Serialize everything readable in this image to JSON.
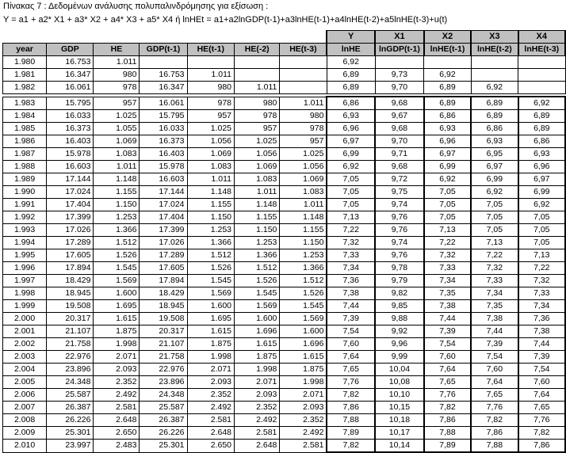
{
  "title_line1": "Πίνακας 7 : Δεδομένων ανάλυσης πολυπαλινδρόμησης για εξίσωση :",
  "title_line2": "Y = a1 + a2* X1 + a3* X2 + a4* X3 + a5* X4  ή   lnHEt = a1+a2lnGDP(t-1)+a3lnHE(t-1)+a4lnHE(t-2)+a5lnHE(t-3)+u(t)",
  "var_labels": [
    "Y",
    "X1",
    "X2",
    "X3",
    "X4"
  ],
  "headers": [
    "year",
    "GDP",
    "HE",
    "GDP(t-1)",
    "HE(t-1)",
    "HE(-2)",
    "HE(t-3)",
    "lnHE",
    "lnGDP(t-1)",
    "lnHE(t-1)",
    "lnHE(t-2)",
    "lnHE(t-3)"
  ],
  "rows_top": [
    [
      "1.980",
      "16.753",
      "1.011",
      "",
      "",
      "",
      "",
      "6,92",
      "",
      "",
      "",
      ""
    ],
    [
      "1.981",
      "16.347",
      "980",
      "16.753",
      "1.011",
      "",
      "",
      "6,89",
      "9,73",
      "6,92",
      "",
      ""
    ],
    [
      "1.982",
      "16.061",
      "978",
      "16.347",
      "980",
      "1.011",
      "",
      "6,89",
      "9,70",
      "6,89",
      "6,92",
      ""
    ]
  ],
  "rows_main": [
    [
      "1.983",
      "15.795",
      "957",
      "16.061",
      "978",
      "980",
      "1.011",
      "6,86",
      "9,68",
      "6,89",
      "6,89",
      "6,92"
    ],
    [
      "1.984",
      "16.033",
      "1.025",
      "15.795",
      "957",
      "978",
      "980",
      "6,93",
      "9,67",
      "6,86",
      "6,89",
      "6,89"
    ],
    [
      "1.985",
      "16.373",
      "1.055",
      "16.033",
      "1.025",
      "957",
      "978",
      "6,96",
      "9,68",
      "6,93",
      "6,86",
      "6,89"
    ],
    [
      "1.986",
      "16.403",
      "1.069",
      "16.373",
      "1.056",
      "1.025",
      "957",
      "6,97",
      "9,70",
      "6,96",
      "6,93",
      "6,86"
    ],
    [
      "1.987",
      "15.978",
      "1.083",
      "16.403",
      "1.069",
      "1.056",
      "1.025",
      "6,99",
      "9,71",
      "6,97",
      "6,95",
      "6,93"
    ],
    [
      "1.988",
      "16.603",
      "1.011",
      "15.978",
      "1.083",
      "1.069",
      "1.056",
      "6,92",
      "9,68",
      "6,99",
      "6,97",
      "6,96"
    ],
    [
      "1.989",
      "17.144",
      "1.148",
      "16.603",
      "1.011",
      "1.083",
      "1.069",
      "7,05",
      "9,72",
      "6,92",
      "6,99",
      "6,97"
    ],
    [
      "1.990",
      "17.024",
      "1.155",
      "17.144",
      "1.148",
      "1.011",
      "1.083",
      "7,05",
      "9,75",
      "7,05",
      "6,92",
      "6,99"
    ],
    [
      "1.991",
      "17.404",
      "1.150",
      "17.024",
      "1.155",
      "1.148",
      "1.011",
      "7,05",
      "9,74",
      "7,05",
      "7,05",
      "6,92"
    ],
    [
      "1.992",
      "17.399",
      "1.253",
      "17.404",
      "1.150",
      "1.155",
      "1.148",
      "7,13",
      "9,76",
      "7,05",
      "7,05",
      "7,05"
    ],
    [
      "1.993",
      "17.026",
      "1.366",
      "17.399",
      "1.253",
      "1.150",
      "1.155",
      "7,22",
      "9,76",
      "7,13",
      "7,05",
      "7,05"
    ],
    [
      "1.994",
      "17.289",
      "1.512",
      "17.026",
      "1.366",
      "1.253",
      "1.150",
      "7,32",
      "9,74",
      "7,22",
      "7,13",
      "7,05"
    ],
    [
      "1.995",
      "17.605",
      "1.526",
      "17.289",
      "1.512",
      "1.366",
      "1.253",
      "7,33",
      "9,76",
      "7,32",
      "7,22",
      "7,13"
    ],
    [
      "1.996",
      "17.894",
      "1.545",
      "17.605",
      "1.526",
      "1.512",
      "1.366",
      "7,34",
      "9,78",
      "7,33",
      "7,32",
      "7,22"
    ],
    [
      "1.997",
      "18.429",
      "1.569",
      "17.894",
      "1.545",
      "1.526",
      "1.512",
      "7,36",
      "9,79",
      "7,34",
      "7,33",
      "7,32"
    ],
    [
      "1.998",
      "18.945",
      "1.600",
      "18.429",
      "1.569",
      "1.545",
      "1.526",
      "7,38",
      "9,82",
      "7,35",
      "7,34",
      "7,33"
    ],
    [
      "1.999",
      "19.508",
      "1.695",
      "18.945",
      "1.600",
      "1.569",
      "1.545",
      "7,44",
      "9,85",
      "7,38",
      "7,35",
      "7,34"
    ],
    [
      "2.000",
      "20.317",
      "1.615",
      "19.508",
      "1.695",
      "1.600",
      "1.569",
      "7,39",
      "9,88",
      "7,44",
      "7,38",
      "7,36"
    ],
    [
      "2.001",
      "21.107",
      "1.875",
      "20.317",
      "1.615",
      "1.696",
      "1.600",
      "7,54",
      "9,92",
      "7,39",
      "7,44",
      "7,38"
    ],
    [
      "2.002",
      "21.758",
      "1.998",
      "21.107",
      "1.875",
      "1.615",
      "1.696",
      "7,60",
      "9,96",
      "7,54",
      "7,39",
      "7,44"
    ],
    [
      "2.003",
      "22.976",
      "2.071",
      "21.758",
      "1.998",
      "1.875",
      "1.615",
      "7,64",
      "9,99",
      "7,60",
      "7,54",
      "7,39"
    ],
    [
      "2.004",
      "23.896",
      "2.093",
      "22.976",
      "2.071",
      "1.998",
      "1.875",
      "7,65",
      "10,04",
      "7,64",
      "7,60",
      "7,54"
    ],
    [
      "2.005",
      "24.348",
      "2.352",
      "23.896",
      "2.093",
      "2.071",
      "1.998",
      "7,76",
      "10,08",
      "7,65",
      "7,64",
      "7,60"
    ],
    [
      "2.006",
      "25.587",
      "2.492",
      "24.348",
      "2.352",
      "2.093",
      "2.071",
      "7,82",
      "10,10",
      "7,76",
      "7,65",
      "7,64"
    ],
    [
      "2.007",
      "26.387",
      "2.581",
      "25.587",
      "2.492",
      "2.352",
      "2.093",
      "7,86",
      "10,15",
      "7,82",
      "7,76",
      "7,65"
    ],
    [
      "2.008",
      "26.226",
      "2.648",
      "26.387",
      "2.581",
      "2.492",
      "2.352",
      "7,88",
      "10,18",
      "7,86",
      "7,82",
      "7,76"
    ],
    [
      "2.009",
      "25.301",
      "2.650",
      "26.226",
      "2.648",
      "2.581",
      "2.492",
      "7,89",
      "10,17",
      "7,88",
      "7,86",
      "7,82"
    ],
    [
      "2.010",
      "23.997",
      "2.483",
      "25.301",
      "2.650",
      "2.648",
      "2.581",
      "7,82",
      "10,14",
      "7,89",
      "7,88",
      "7,86"
    ]
  ]
}
